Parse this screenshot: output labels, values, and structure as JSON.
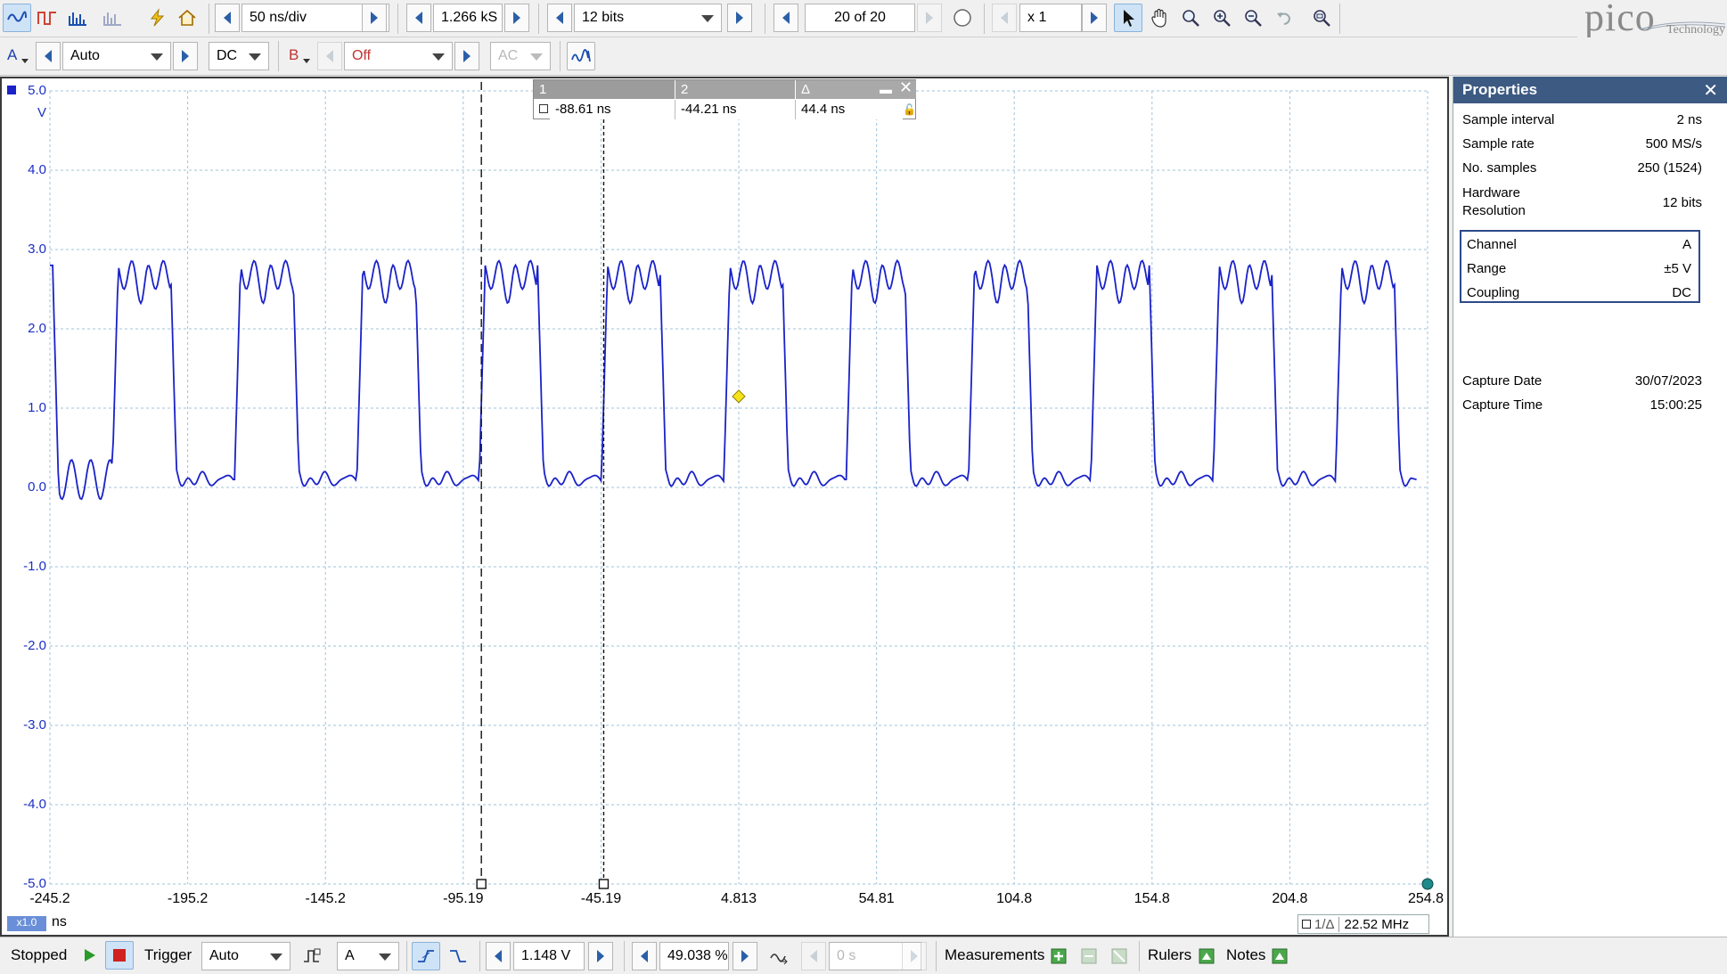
{
  "toolbar1": {
    "timebase": "50 ns/div",
    "samples": "1.266 kS",
    "resolution": "12 bits",
    "buffer": "20 of 20",
    "zoom": "x 1"
  },
  "toolbar2": {
    "chA_label": "A",
    "chA_range": "Auto",
    "chA_coupling": "DC",
    "chB_label": "B",
    "chB_range": "Off",
    "chB_coupling": "AC"
  },
  "brand": {
    "name": "pico",
    "sub": "Technology"
  },
  "rulers": {
    "h1": "1",
    "h2": "2",
    "hd": "Δ",
    "v1": "-88.61 ns",
    "v2": "-44.21 ns",
    "vd": "44.4 ns"
  },
  "axis": {
    "y_unit": "V",
    "y_ticks": [
      "5.0",
      "4.0",
      "3.0",
      "2.0",
      "1.0",
      "0.0",
      "-1.0",
      "-2.0",
      "-3.0",
      "-4.0",
      "-5.0"
    ],
    "x_unit": "ns",
    "x_ticks": [
      "-245.2",
      "-195.2",
      "-145.2",
      "-95.19",
      "-45.19",
      "4.813",
      "54.81",
      "104.8",
      "154.8",
      "204.8",
      "254.8"
    ],
    "zoom_badge": "x1.0",
    "freq_label": "1/Δ",
    "freq_value": "22.52 MHz"
  },
  "properties": {
    "title": "Properties",
    "rows": [
      {
        "k": "Sample interval",
        "v": "2 ns"
      },
      {
        "k": "Sample rate",
        "v": "500 MS/s"
      },
      {
        "k": "No. samples",
        "v": "250  (1524)"
      },
      {
        "k": "Hardware Resolution",
        "v": "12 bits"
      }
    ],
    "channel": [
      {
        "k": "Channel",
        "v": "A"
      },
      {
        "k": "Range",
        "v": "±5 V"
      },
      {
        "k": "Coupling",
        "v": "DC"
      }
    ],
    "capture": [
      {
        "k": "Capture Date",
        "v": "30/07/2023"
      },
      {
        "k": "Capture Time",
        "v": "15:00:25"
      }
    ]
  },
  "statusbar": {
    "state": "Stopped",
    "trigger_label": "Trigger",
    "trigger_mode": "Auto",
    "trigger_source": "A",
    "trigger_level": "1.148 V",
    "pretrigger": "49.038 %",
    "delay": "0 s",
    "measurements": "Measurements",
    "rulers": "Rulers",
    "notes": "Notes"
  },
  "colors": {
    "trace": "#1a22c8",
    "grid": "#9fc3d8",
    "accent": "#2a5fa8",
    "panel_header": "#3c5a82"
  },
  "chart_data": {
    "type": "line",
    "xlim": [
      -245.2,
      254.8
    ],
    "ylim": [
      -5.0,
      5.0
    ],
    "x_unit": "ns",
    "y_unit": "V",
    "grid": true,
    "series": [
      {
        "period_ns": 44.4,
        "high_v": 2.8,
        "low_v": 0.1,
        "rising_edges_ns": [
          -222.6,
          -178.2,
          -133.8,
          -89.4,
          -45.0,
          -0.6,
          43.8,
          88.2,
          132.6,
          177.0,
          221.4
        ],
        "falling_edges_ns": [
          -201.4,
          -157.0,
          -112.6,
          -68.2,
          -23.8,
          20.6,
          65.0,
          109.4,
          153.8,
          198.2,
          242.6
        ]
      }
    ],
    "ruler_positions_ns": [
      -88.61,
      -44.21
    ],
    "trigger_point": {
      "x_ns": 4.8,
      "y_v": 1.148
    }
  }
}
